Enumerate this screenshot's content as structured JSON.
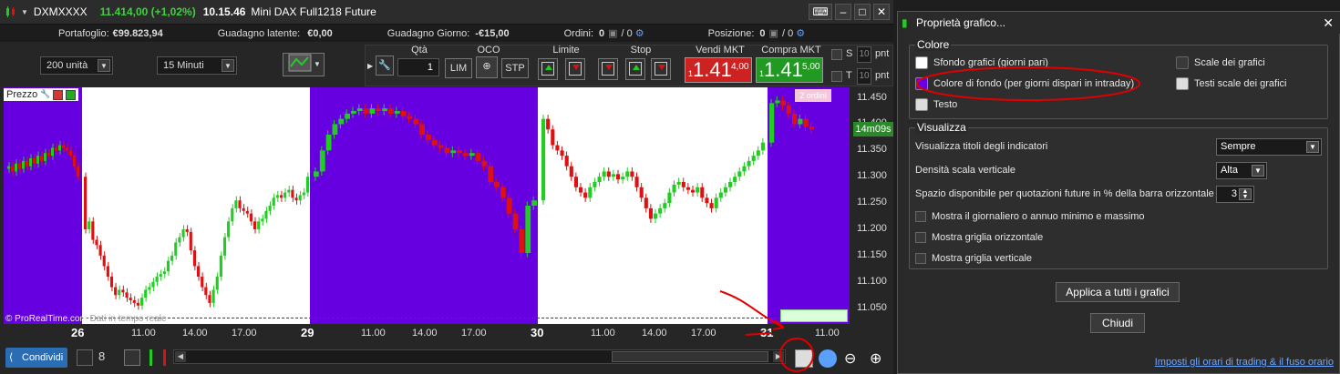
{
  "window": {
    "symbol": "DXMXXXX",
    "price": "11.414,00 (+1,02%)",
    "time": "10.15.46",
    "name": "Mini DAX Full1218 Future"
  },
  "info": {
    "portafoglio_label": "Portafoglio:",
    "portafoglio_value": "€99.823,94",
    "latente_label": "Guadagno latente:",
    "latente_value": "€0,00",
    "giorno_label": "Guadagno Giorno:",
    "giorno_value": "-€15,00",
    "ordini_label": "Ordini:",
    "ordini_value": "0",
    "ordini_total": "/ 0",
    "posizione_label": "Posizione:",
    "posizione_value": "0",
    "posizione_total": "/ 0"
  },
  "toolbar": {
    "units": "200 unità",
    "interval": "15 Minuti",
    "qta_label": "Qtà",
    "qta_value": "1",
    "oco_label": "OCO",
    "limite_label": "Limite",
    "stop_label": "Stop",
    "vendi_label": "Vendi MKT",
    "compra_label": "Compra MKT",
    "lim": "LIM",
    "stp": "STP",
    "vendi_small": "1",
    "vendi_big": "1.41",
    "vendi_sup": "4,00",
    "compra_small": "1",
    "compra_big": "1.41",
    "compra_sup": "5,00",
    "s_label": "S",
    "t_label": "T",
    "s_val": "10",
    "t_val": "10",
    "pnt1": "pnt",
    "pnt2": "pnt"
  },
  "chart": {
    "panel_label": "Prezzo",
    "watermark": "© ProRealTime.com",
    "watermark_dim": "Dati in tempo reale",
    "timer": "14m09s",
    "orders_tag": "2 ordini",
    "y_ticks": [
      "11.450",
      "11.400",
      "11.350",
      "11.300",
      "11.250",
      "11.200",
      "11.150",
      "11.100",
      "11.050"
    ],
    "x_labels": [
      {
        "t": "26",
        "day": true
      },
      {
        "t": "11.00",
        "day": false
      },
      {
        "t": "14.00",
        "day": false
      },
      {
        "t": "17.00",
        "day": false
      },
      {
        "t": "29",
        "day": true
      },
      {
        "t": "11.00",
        "day": false
      },
      {
        "t": "14.00",
        "day": false
      },
      {
        "t": "17.00",
        "day": false
      },
      {
        "t": "30",
        "day": true
      },
      {
        "t": "11.00",
        "day": false
      },
      {
        "t": "14.00",
        "day": false
      },
      {
        "t": "17.00",
        "day": false
      },
      {
        "t": "31",
        "day": true
      },
      {
        "t": "11.00",
        "day": false
      }
    ]
  },
  "bottom": {
    "share_label": "Condividi"
  },
  "dialog": {
    "title": "Proprietà grafico...",
    "colore_legend": "Colore",
    "sfondo": "Sfondo grafici (giorni pari)",
    "colore_fondo": "Colore di fondo (per giorni dispari in intraday)",
    "testo": "Testo",
    "scale": "Scale dei grafici",
    "testi_scale": "Testi scale dei grafici",
    "visualizza_legend": "Visualizza",
    "titoli_label": "Visualizza titoli degli indicatori",
    "titoli_value": "Sempre",
    "densita_label": "Densità scala verticale",
    "densita_value": "Alta",
    "spazio_label": "Spazio disponibile per quotazioni future in % della barra orizzontale",
    "spazio_value": "3",
    "giornaliero": "Mostra il giornaliero o annuo minimo e massimo",
    "griglia_orizz": "Mostra griglia orizzontale",
    "griglia_vert": "Mostra griglia verticale",
    "applica": "Applica a tutti i grafici",
    "chiudi": "Chiudi",
    "link": "Imposti gli orari di trading & il fuso orario"
  },
  "colors": {
    "band": "#6600e0",
    "up": "#22cc22",
    "down": "#dd1111",
    "annotation": "#e00000"
  },
  "candles": [
    11320,
    11310,
    11325,
    11315,
    11330,
    11320,
    11335,
    11325,
    11340,
    11330,
    11345,
    11340,
    11355,
    11350,
    11360,
    11355,
    11350,
    11340,
    11320,
    11300,
    11200,
    11215,
    11180,
    11170,
    11150,
    11130,
    11110,
    11090,
    11075,
    11085,
    11080,
    11070,
    11065,
    11060,
    11055,
    11070,
    11085,
    11090,
    11100,
    11110,
    11115,
    11120,
    11140,
    11150,
    11175,
    11185,
    11200,
    11195,
    11160,
    11130,
    11110,
    11090,
    11075,
    11060,
    11085,
    11110,
    11150,
    11185,
    11215,
    11240,
    11255,
    11240,
    11235,
    11230,
    11215,
    11200,
    11215,
    11220,
    11235,
    11245,
    11260,
    11265,
    11260,
    11270,
    11275,
    11260,
    11255,
    11265,
    11270,
    11300,
    11310,
    11350,
    11380,
    11400,
    11410,
    11420,
    11425,
    11430,
    11420,
    11430,
    11425,
    11430,
    11420,
    11425,
    11415,
    11410,
    11400,
    11380,
    11370,
    11360,
    11355,
    11345,
    11350,
    11345,
    11340,
    11345,
    11330,
    11320,
    11290,
    11280,
    11260,
    11230,
    11200,
    11155,
    11245,
    11255,
    11410,
    11390,
    11360,
    11350,
    11340,
    11320,
    11300,
    11280,
    11270,
    11260,
    11280,
    11290,
    11300,
    11310,
    11300,
    11305,
    11295,
    11300,
    11310,
    11300,
    11280,
    11260,
    11240,
    11220,
    11230,
    11240,
    11250,
    11270,
    11285,
    11290,
    11280,
    11275,
    11270,
    11280,
    11260,
    11250,
    11240,
    11260,
    11270,
    11280,
    11290,
    11300,
    11310,
    11320,
    11330,
    11340,
    11350,
    11365,
    11440,
    11445,
    11435,
    11420,
    11400,
    11410,
    11395,
    11390
  ]
}
